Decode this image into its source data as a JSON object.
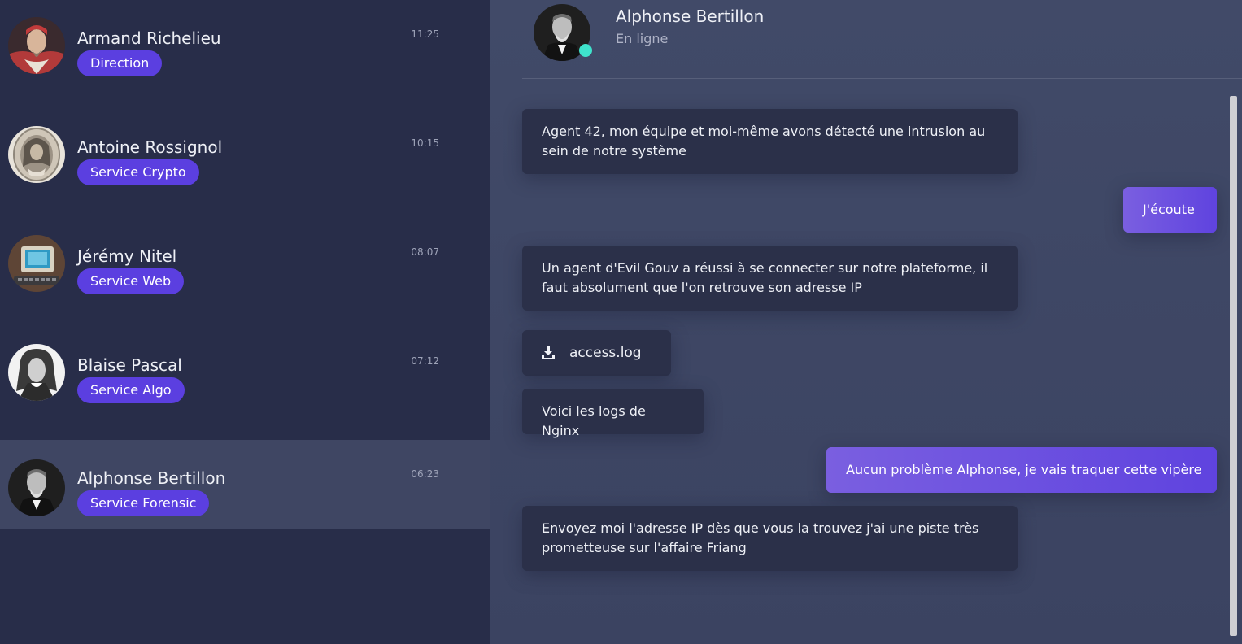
{
  "contacts": [
    {
      "name": "Armand Richelieu",
      "department": "Direction",
      "time": "11:25",
      "avatar_icon": "portrait-richelieu"
    },
    {
      "name": "Antoine Rossignol",
      "department": "Service Crypto",
      "time": "10:15",
      "avatar_icon": "portrait-rossignol"
    },
    {
      "name": "Jérémy Nitel",
      "department": "Service Web",
      "time": "08:07",
      "avatar_icon": "vintage-computer"
    },
    {
      "name": "Blaise Pascal",
      "department": "Service Algo",
      "time": "07:12",
      "avatar_icon": "portrait-pascal"
    },
    {
      "name": "Alphonse Bertillon",
      "department": "Service Forensic",
      "time": "06:23",
      "avatar_icon": "portrait-bertillon",
      "active": true
    }
  ],
  "chat": {
    "contact_name": "Alphonse Bertillon",
    "status": "En ligne",
    "status_color": "#3fe3cc",
    "messages": [
      {
        "direction": "in",
        "text": "Agent 42, mon équipe et moi-même avons détecté une intrusion au sein de notre système"
      },
      {
        "direction": "out",
        "text": "J'écoute"
      },
      {
        "direction": "in",
        "text": "Un agent d'Evil Gouv a réussi à se connecter sur notre plateforme, il faut absolument que l'on retrouve son adresse IP"
      },
      {
        "direction": "in",
        "type": "file",
        "file_name": "access.log",
        "icon": "download-icon"
      },
      {
        "direction": "in",
        "text": "Voici les logs de Nginx"
      },
      {
        "direction": "out",
        "text": "Aucun problème Alphonse, je vais traquer cette vipère"
      },
      {
        "direction": "in",
        "text": "Envoyez moi l'adresse IP dès que vous la trouvez j'ai une piste très prometteuse sur l'affaire Friang"
      }
    ]
  },
  "colors": {
    "sidebar_bg": "#282d49",
    "active_contact_bg": "#3f4663",
    "tag_bg": "#5b3fe0",
    "incoming_bubble": "#2b3049",
    "outgoing_bubble": "#6a4fe0"
  }
}
